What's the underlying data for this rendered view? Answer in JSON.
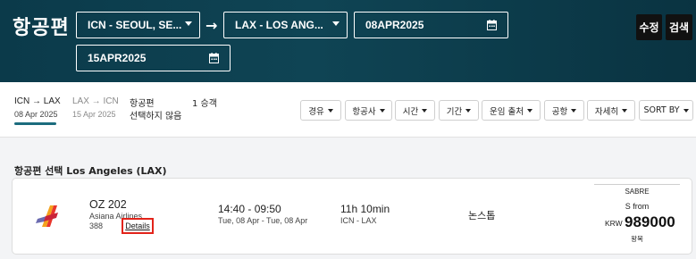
{
  "header": {
    "title": "항공편",
    "origin": "ICN - SEOUL, SE...",
    "destination": "LAX - LOS ANG...",
    "arrow": "→",
    "depart_date": "08APR2025",
    "return_date": "15APR2025",
    "edit_button": "수정",
    "search_button": "검색"
  },
  "legs": [
    {
      "route": "ICN → LAX",
      "date": "08 Apr 2025",
      "active": true
    },
    {
      "route": "LAX → ICN",
      "date": "15 Apr 2025",
      "active": false
    }
  ],
  "strip": {
    "flight_label": "항공편",
    "flight_status": "선택하지 않음",
    "passengers": "1 승객"
  },
  "filters": [
    "경유",
    "항공사",
    "시간",
    "기간",
    "운임 출처",
    "공항",
    "자세히",
    "SORT BY"
  ],
  "results": {
    "section_title": "항공편 선택 Los Angeles (LAX)",
    "flight": {
      "number": "OZ 202",
      "airline": "Asiana Airlines",
      "aircraft": "388",
      "details_link": "Details",
      "times": "14:40 - 09:50",
      "dates": "Tue, 08 Apr - Tue, 08 Apr",
      "duration": "11h 10min",
      "od": "ICN - LAX",
      "stops": "논스톱",
      "price_source": "SABRE",
      "from_label": "S from",
      "currency": "KRW",
      "amount": "989000",
      "trip_type": "왕복"
    }
  },
  "colors": {
    "header_bg": "#0f4454",
    "accent": "#1c6c7e",
    "highlight": "#e2231a"
  }
}
